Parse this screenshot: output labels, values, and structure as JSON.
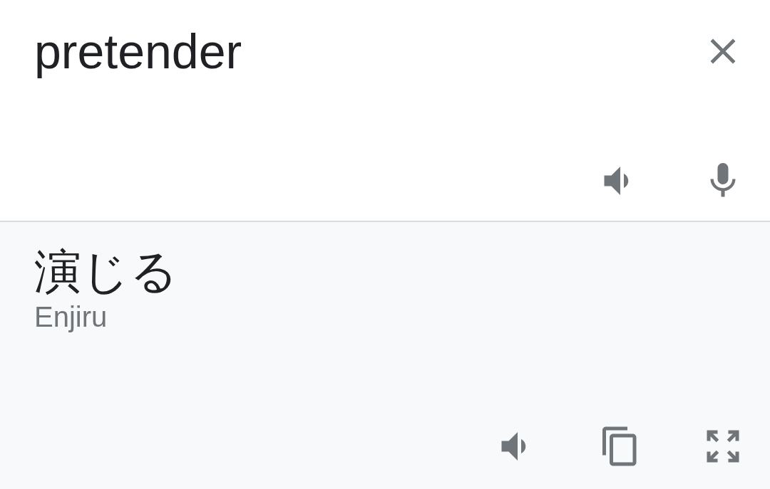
{
  "source": {
    "value": "pretender"
  },
  "translation": {
    "text": "演じる",
    "romanization": "Enjiru"
  }
}
